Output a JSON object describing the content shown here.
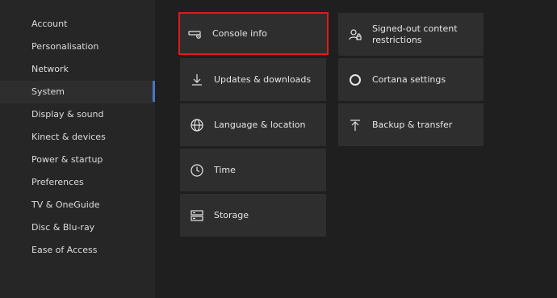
{
  "sidebar": {
    "items": [
      {
        "label": "Account"
      },
      {
        "label": "Personalisation"
      },
      {
        "label": "Network"
      },
      {
        "label": "System"
      },
      {
        "label": "Display & sound"
      },
      {
        "label": "Kinect & devices"
      },
      {
        "label": "Power & startup"
      },
      {
        "label": "Preferences"
      },
      {
        "label": "TV & OneGuide"
      },
      {
        "label": "Disc & Blu-ray"
      },
      {
        "label": "Ease of Access"
      }
    ],
    "selected": "System"
  },
  "tiles": {
    "console_info": {
      "label": "Console info",
      "icon": "console-icon"
    },
    "updates": {
      "label": "Updates & downloads",
      "icon": "download-icon"
    },
    "language": {
      "label": "Language & location",
      "icon": "globe-icon"
    },
    "time": {
      "label": "Time",
      "icon": "clock-icon"
    },
    "storage": {
      "label": "Storage",
      "icon": "storage-icon"
    },
    "signed_out": {
      "label": "Signed-out content restrictions",
      "icon": "user-lock-icon"
    },
    "cortana": {
      "label": "Cortana settings",
      "icon": "circle-icon"
    },
    "backup": {
      "label": "Backup & transfer",
      "icon": "upload-icon"
    }
  },
  "colors": {
    "background": "#1f1f1f",
    "sidebar": "#262626",
    "tile": "#2e2e2e",
    "highlight": "#e01b1b",
    "accent": "#4a74c9"
  }
}
